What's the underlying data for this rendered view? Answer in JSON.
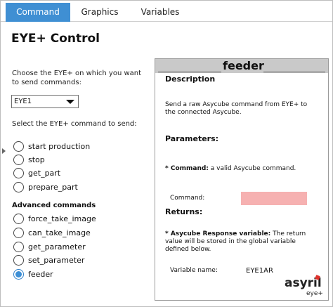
{
  "tabs": [
    {
      "label": "Command",
      "active": true
    },
    {
      "label": "Graphics",
      "active": false
    },
    {
      "label": "Variables",
      "active": false
    }
  ],
  "page_title": "EYE+ Control",
  "choose_text": "Choose the EYE+ on which you want to send commands:",
  "eye_select": {
    "value": "EYE1"
  },
  "select_command_text": "Select the EYE+ command to send:",
  "commands": [
    {
      "label": "start production",
      "checked": false
    },
    {
      "label": "stop",
      "checked": false
    },
    {
      "label": "get_part",
      "checked": false
    },
    {
      "label": "prepare_part",
      "checked": false
    }
  ],
  "advanced_heading": "Advanced commands",
  "advanced_commands": [
    {
      "label": "force_take_image",
      "checked": false
    },
    {
      "label": "can_take_image",
      "checked": false
    },
    {
      "label": "get_parameter",
      "checked": false
    },
    {
      "label": "set_parameter",
      "checked": false
    },
    {
      "label": "feeder",
      "checked": true
    }
  ],
  "panel": {
    "title": "feeder",
    "description_heading": "Description",
    "description_text": "Send a raw Asycube command from EYE+ to the connected Asycube.",
    "parameters_heading": "Parameters:",
    "param_name": "* Command:",
    "param_desc": " a valid Asycube command.",
    "command_label": "Command:",
    "command_value": "",
    "returns_heading": "Returns:",
    "return_name": "* Asycube Response variable:",
    "return_desc": " The return value will be stored in the global variable defined below.",
    "variable_label": "Variable name:",
    "variable_value": "EYE1AR"
  },
  "logo": {
    "word": "asyril",
    "sub": "eye+"
  },
  "colors": {
    "accent": "#3f8fd3",
    "panel_header": "#c9c9c9",
    "command_field": "#f6b1b1"
  }
}
